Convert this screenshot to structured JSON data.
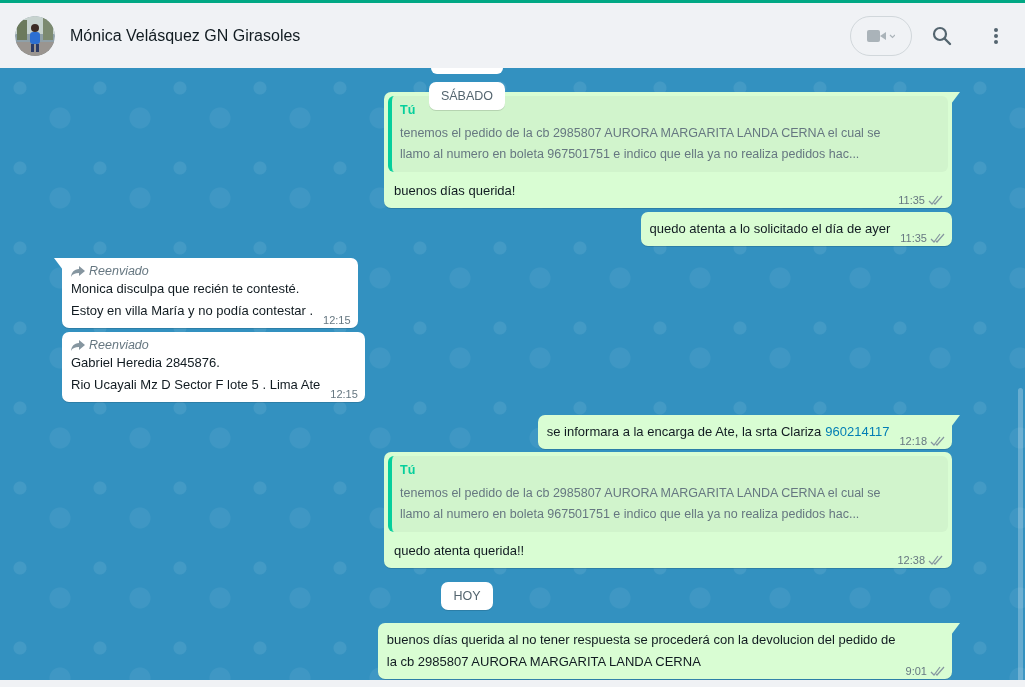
{
  "header": {
    "contact_name": "Mónica Velásquez GN Girasoles"
  },
  "messages": [
    {
      "kind": "date",
      "label": "SÁBADO"
    },
    {
      "kind": "message",
      "outgoing": true,
      "tail": true,
      "quote": {
        "author": "Tú",
        "lines": [
          "tenemos el pedido de la cb 2985807 AURORA MARGARITA LANDA CERNA el cual se",
          "llamo al numero en boleta 967501751  e indico que ella ya no realiza pedidos hac..."
        ]
      },
      "lines": [
        "buenos días querida!"
      ],
      "time": "11:35"
    },
    {
      "kind": "message",
      "outgoing": true,
      "tail": false,
      "lines": [
        "quedo atenta a lo solicitado el día de ayer"
      ],
      "time": "11:35"
    },
    {
      "kind": "message",
      "outgoing": false,
      "tail": true,
      "forward_label": "Reenviado",
      "lines": [
        "Monica disculpa que recién te contesté.",
        "Estoy en villa María y no podía contestar ."
      ],
      "time": "12:15"
    },
    {
      "kind": "message",
      "outgoing": false,
      "tail": false,
      "forward_label": "Reenviado",
      "lines": [
        "Gabriel Heredia 2845876.",
        "Rio Ucayali Mz D Sector F lote 5 . Lima Ate"
      ],
      "time": "12:15"
    },
    {
      "kind": "message",
      "outgoing": true,
      "tail": true,
      "lines": [
        "se informara a la encarga de Ate, la srta Clariza"
      ],
      "link": "960214117",
      "time": "12:18"
    },
    {
      "kind": "message",
      "outgoing": true,
      "tail": false,
      "quote": {
        "author": "Tú",
        "lines": [
          "tenemos el pedido de la cb 2985807 AURORA MARGARITA LANDA CERNA el cual se",
          "llamo al numero en boleta 967501751  e indico que ella ya no realiza pedidos hac..."
        ]
      },
      "lines": [
        "quedo atenta querida!!"
      ],
      "time": "12:38"
    },
    {
      "kind": "date",
      "label": "HOY"
    },
    {
      "kind": "message",
      "outgoing": true,
      "tail": true,
      "lines": [
        "buenos días querida al no tener respuesta se procederá con la devolucion del pedido de",
        "la cb 2985807 AURORA MARGARITA LANDA CERNA"
      ],
      "time": "9:01"
    }
  ]
}
